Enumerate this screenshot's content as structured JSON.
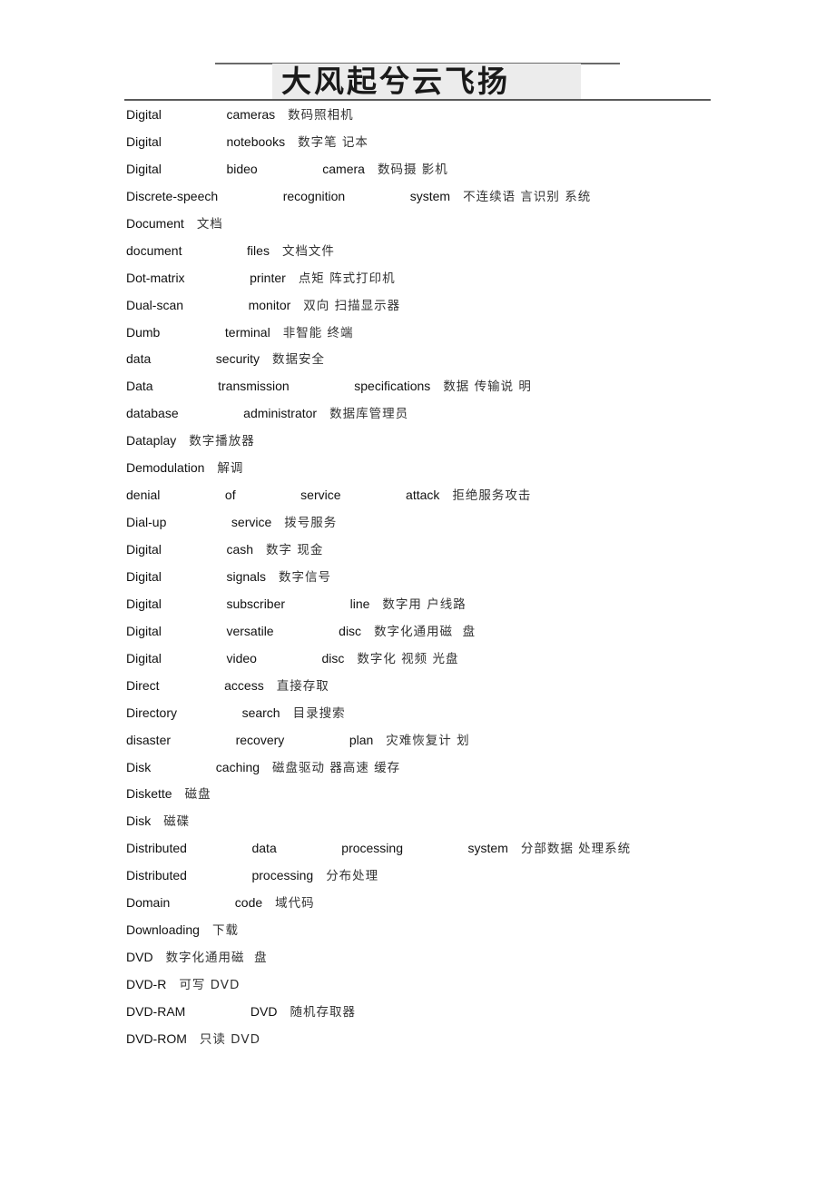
{
  "header": {
    "title": "大风起兮云飞扬"
  },
  "entries": [
    {
      "en": "Digital    cameras",
      "cn": "数码照相机"
    },
    {
      "en": "Digital    notebooks",
      "cn": "数字笔 记本"
    },
    {
      "en": "Digital    bideo    camera",
      "cn": "数码摄 影机"
    },
    {
      "en": "Discrete-speech    recognition    system",
      "cn": "不连续语 言识别 系统"
    },
    {
      "en": "Document",
      "cn": "文档"
    },
    {
      "en": "document    files",
      "cn": "文档文件"
    },
    {
      "en": "Dot-matrix    printer",
      "cn": "点矩 阵式打印机"
    },
    {
      "en": "Dual-scan    monitor",
      "cn": "双向 扫描显示器"
    },
    {
      "en": "Dumb    terminal",
      "cn": "非智能 终端"
    },
    {
      "en": "data    security",
      "cn": "数据安全"
    },
    {
      "en": "Data    transmission    specifications",
      "cn": "数据 传输说 明"
    },
    {
      "en": "database    administrator",
      "cn": "数据库管理员"
    },
    {
      "en": "Dataplay",
      "cn": "数字播放器"
    },
    {
      "en": "Demodulation",
      "cn": "解调"
    },
    {
      "en": "denial    of    service    attack",
      "cn": "拒绝服务攻击"
    },
    {
      "en": "Dial-up    service",
      "cn": "拨号服务"
    },
    {
      "en": "Digital    cash",
      "cn": "数字 现金"
    },
    {
      "en": "Digital    signals",
      "cn": "数字信号"
    },
    {
      "en": "Digital    subscriber    line",
      "cn": "数字用 户线路"
    },
    {
      "en": "Digital    versatile    disc",
      "cn": "数字化通用磁  盘"
    },
    {
      "en": "Digital    video    disc",
      "cn": "数字化 视频 光盘"
    },
    {
      "en": "Direct    access",
      "cn": "直接存取"
    },
    {
      "en": "Directory    search",
      "cn": "目录搜索"
    },
    {
      "en": "disaster    recovery    plan",
      "cn": "灾难恢复计 划"
    },
    {
      "en": "Disk    caching",
      "cn": "磁盘驱动 器高速 缓存"
    },
    {
      "en": "Diskette",
      "cn": "磁盘"
    },
    {
      "en": "Disk",
      "cn": "磁碟"
    },
    {
      "en": "Distributed    data    processing    system",
      "cn": "分部数据 处理系统"
    },
    {
      "en": "Distributed    processing",
      "cn": "分布处理"
    },
    {
      "en": "Domain    code",
      "cn": "域代码"
    },
    {
      "en": "Downloading",
      "cn": "下载"
    },
    {
      "en": "DVD",
      "cn": "数字化通用磁  盘"
    },
    {
      "en": "DVD-R",
      "cn": "可写 DVD"
    },
    {
      "en": "DVD-RAM    DVD",
      "cn": "随机存取器"
    },
    {
      "en": "DVD-ROM",
      "cn": "只读 DVD"
    }
  ]
}
